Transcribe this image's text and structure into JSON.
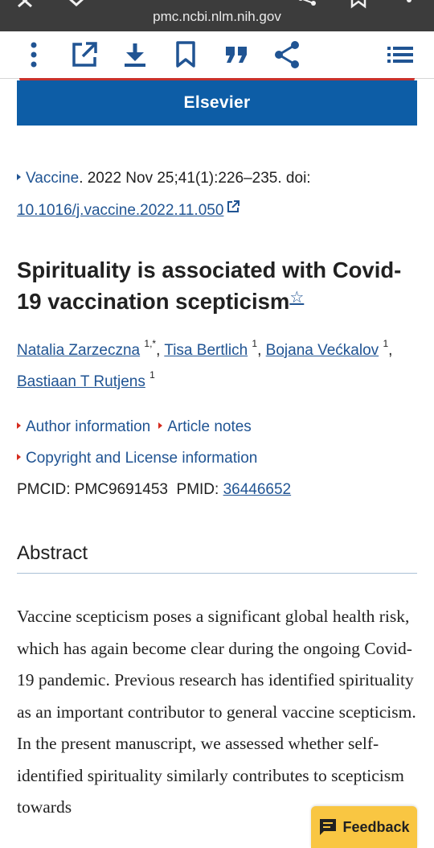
{
  "browser": {
    "url": "pmc.ncbi.nlm.nih.gov",
    "icons": [
      "close-icon",
      "chevron-down-icon",
      "share-icon",
      "bookmark-icon",
      "more-vert-icon"
    ]
  },
  "toolbar": {
    "icons": [
      "more-vert-icon",
      "open-external-icon",
      "download-icon",
      "bookmark-icon",
      "cite-quote-icon",
      "share-icon",
      "table-of-contents-icon"
    ],
    "accent_color": "#205493"
  },
  "banner": {
    "publisher": "Elsevier",
    "color": "#0d5da6",
    "accent_red": "#c8312b"
  },
  "citation": {
    "journal": "Vaccine",
    "details": ". 2022 Nov 25;41(1):226–235. doi: ",
    "doi": "10.1016/j.vaccine.2022.11.050"
  },
  "article": {
    "title": "Spirituality is associated with Covid-19 vaccination scepticism",
    "title_note_marker": "☆"
  },
  "authors": [
    {
      "name": "Natalia Zarzeczna",
      "aff": "1,*"
    },
    {
      "name": "Tisa Bertlich",
      "aff": "1"
    },
    {
      "name": "Bojana Većkalov",
      "aff": "1"
    },
    {
      "name": "Bastiaan T Rutjens",
      "aff": "1"
    }
  ],
  "meta": {
    "author_information": "Author information",
    "article_notes": "Article notes",
    "copyright": "Copyright and License information",
    "pmcid": "PMCID: PMC9691453",
    "pmid_label": "PMID: ",
    "pmid": "36446652"
  },
  "abstract": {
    "heading": "Abstract",
    "text": "Vaccine scepticism poses a significant global health risk, which has again become clear during the ongoing Covid-19 pandemic. Previous research has identified spirituality as an important contributor to general vaccine scepticism. In the present manuscript, we assessed whether self-identified spirituality similarly contributes to scepticism towards"
  },
  "feedback": {
    "label": "Feedback",
    "color": "#f9c642"
  }
}
